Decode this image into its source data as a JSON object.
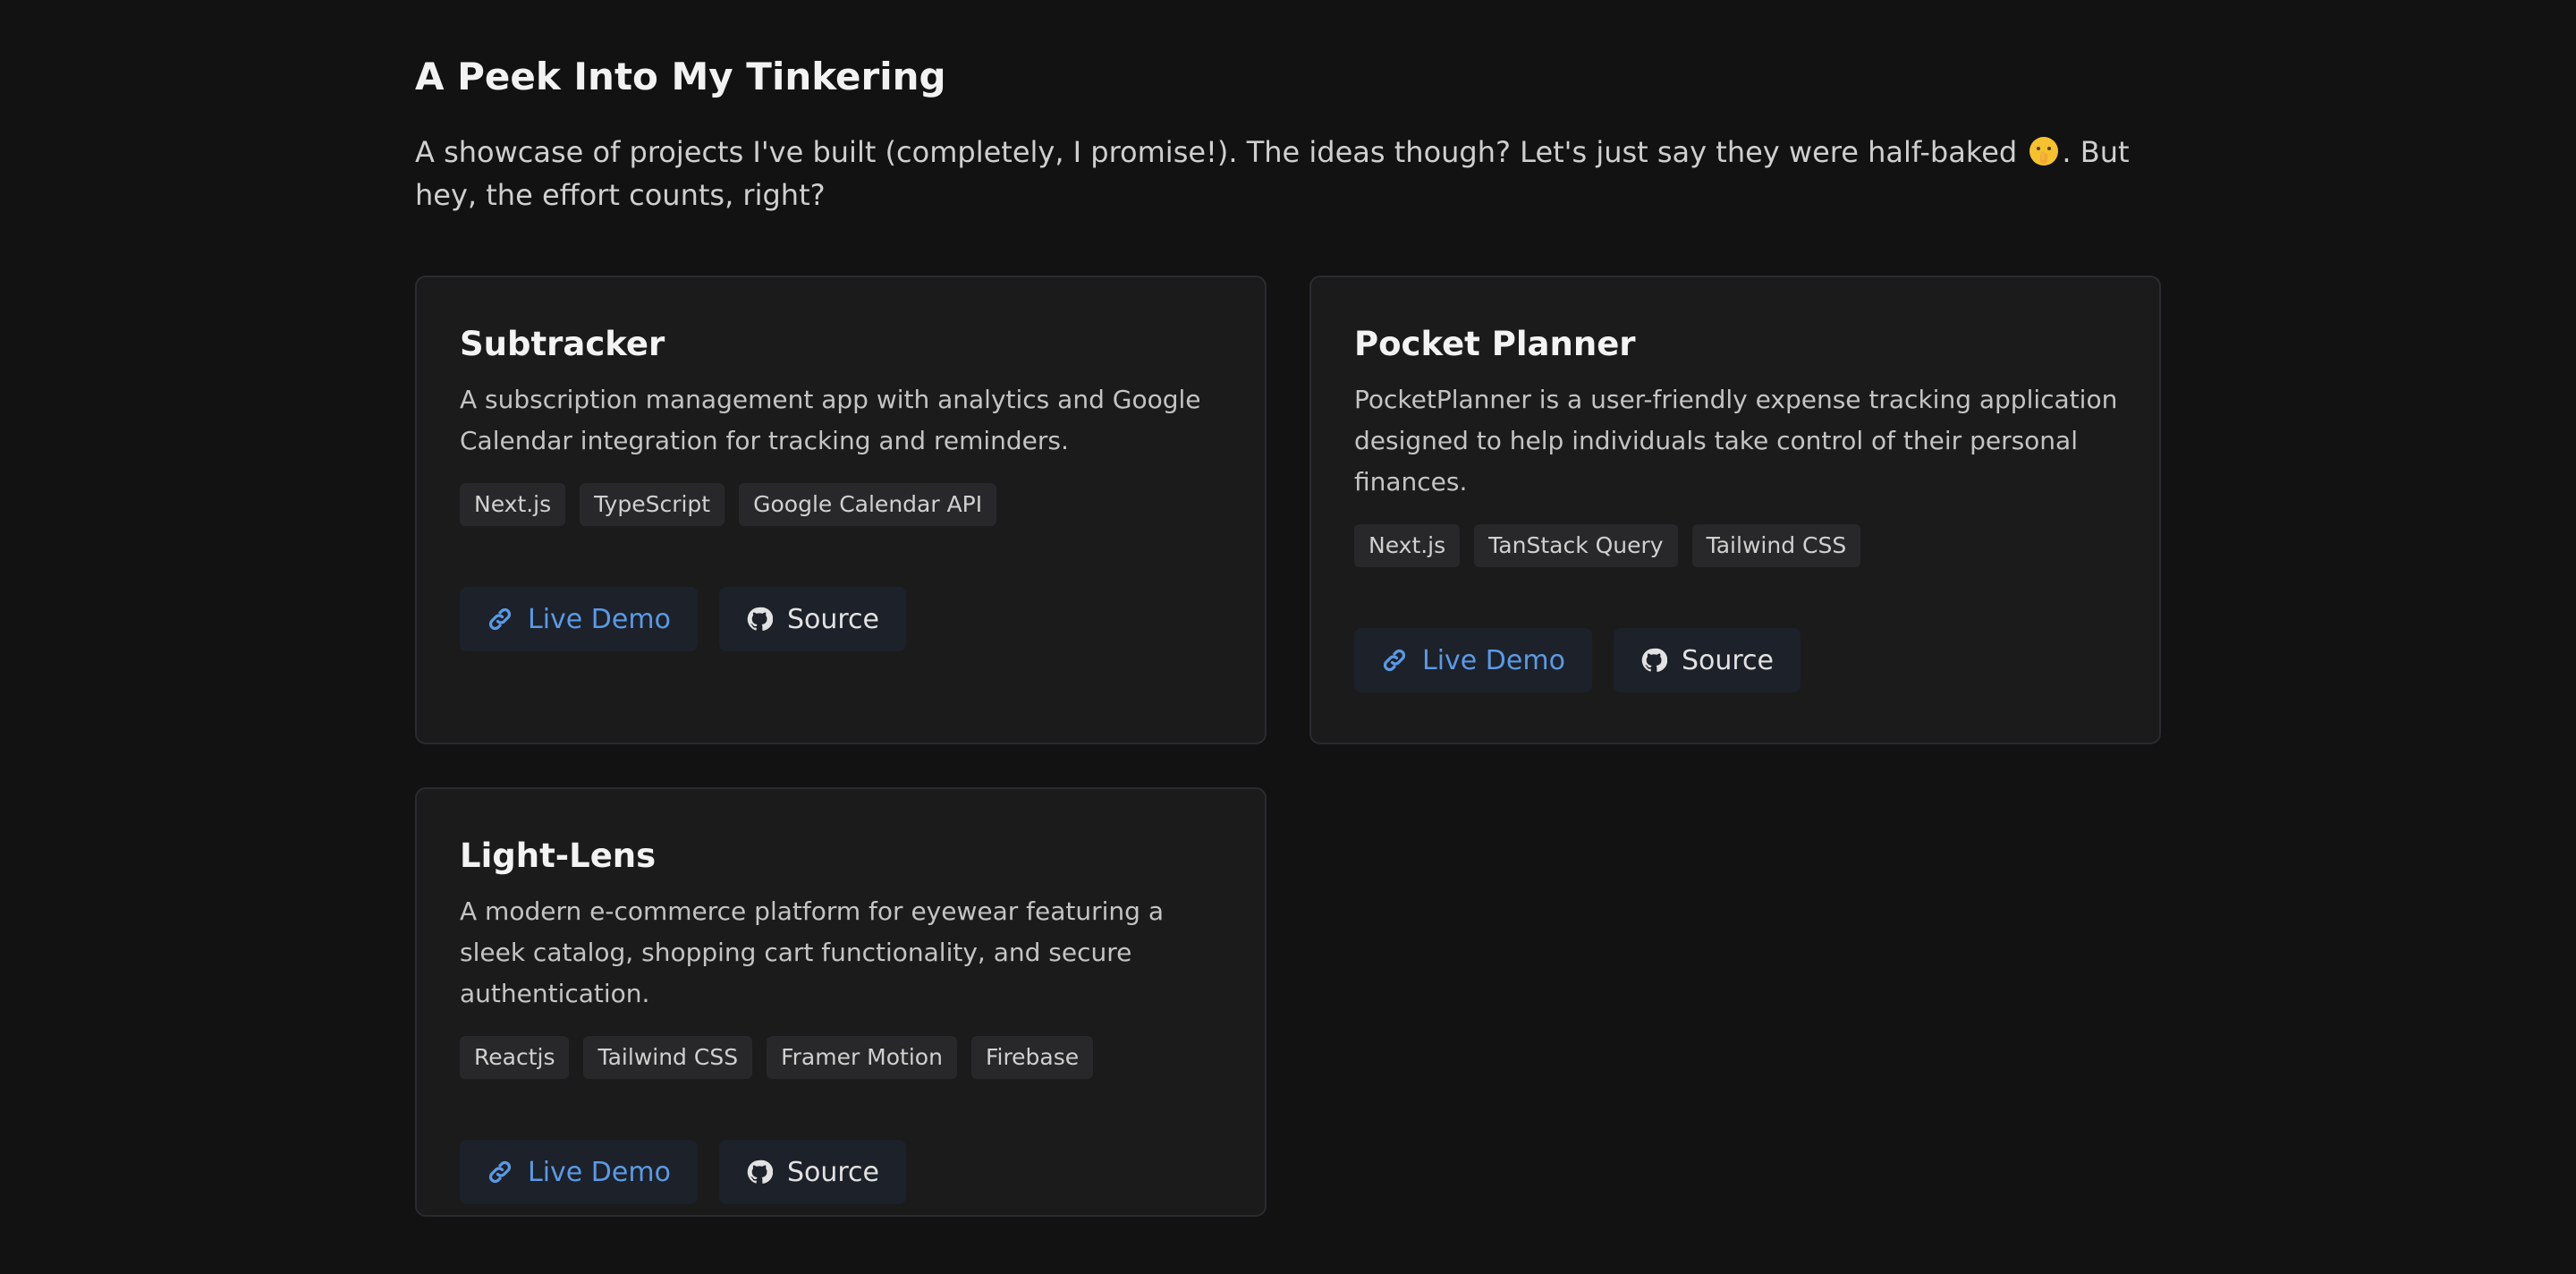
{
  "header": {
    "title": "A Peek Into My Tinkering",
    "intro_before_emoji": "A showcase of projects I've built (completely, I promise!). The ideas though? Let's just say they were half-baked",
    "intro_after_emoji": ". But hey, the effort counts, right?",
    "emoji_name": "shushing-face-emoji"
  },
  "projects": [
    {
      "title": "Subtracker",
      "description": "A subscription management app with analytics and Google Calendar integration for tracking and reminders.",
      "tags": [
        "Next.js",
        "TypeScript",
        "Google Calendar API"
      ],
      "live_label": "Live Demo",
      "source_label": "Source"
    },
    {
      "title": "Pocket Planner",
      "description": "PocketPlanner is a user-friendly expense tracking application designed to help individuals take control of their personal finances.",
      "tags": [
        "Next.js",
        "TanStack Query",
        "Tailwind CSS"
      ],
      "live_label": "Live Demo",
      "source_label": "Source"
    },
    {
      "title": "Light-Lens",
      "description": "A modern e-commerce platform for eyewear featuring a sleek catalog, shopping cart functionality, and secure authentication.",
      "tags": [
        "Reactjs",
        "Tailwind CSS",
        "Framer Motion",
        "Firebase"
      ],
      "live_label": "Live Demo",
      "source_label": "Source"
    }
  ],
  "icons": {
    "live": "link-icon",
    "source": "github-icon"
  },
  "colors": {
    "background": "#121212",
    "card": "#1b1b1c",
    "accent": "#5a9ae6"
  }
}
